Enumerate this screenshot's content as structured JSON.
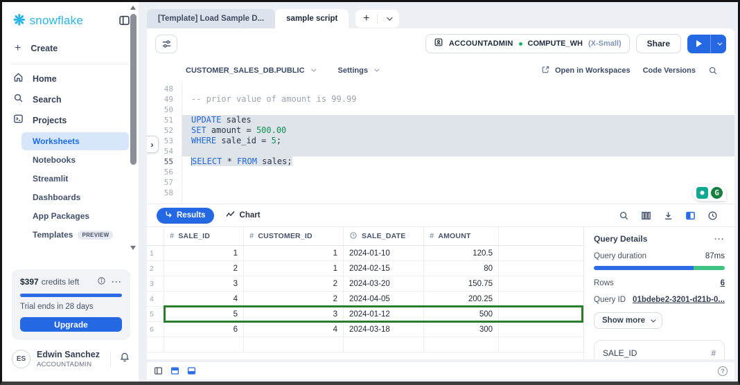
{
  "sidebar": {
    "logo_text": "snowflake",
    "create_label": "Create",
    "nav": [
      {
        "icon": "home",
        "label": "Home"
      },
      {
        "icon": "search",
        "label": "Search"
      },
      {
        "icon": "projects",
        "label": "Projects"
      }
    ],
    "sub_nav": [
      {
        "label": "Worksheets",
        "selected": true
      },
      {
        "label": "Notebooks"
      },
      {
        "label": "Streamlit"
      },
      {
        "label": "Dashboards"
      },
      {
        "label": "App Packages"
      },
      {
        "label": "Templates",
        "badge": "PREVIEW"
      }
    ],
    "credits": {
      "amount": "$397",
      "suffix": "credits left",
      "trial": "Trial ends in 28 days",
      "upgrade_label": "Upgrade"
    },
    "user": {
      "initials": "ES",
      "name": "Edwin Sanchez",
      "role": "ACCOUNTADMIN"
    }
  },
  "tabs": [
    {
      "label": "[Template] Load Sample D...",
      "active": false
    },
    {
      "label": "sample script",
      "active": true
    }
  ],
  "toolbar": {
    "role": "ACCOUNTADMIN",
    "warehouse": "COMPUTE_WH",
    "warehouse_size": "(X-Small)",
    "share_label": "Share"
  },
  "context_bar": {
    "database": "CUSTOMER_SALES_DB.PUBLIC",
    "settings_label": "Settings",
    "open_in_workspaces": "Open in Workspaces",
    "code_versions": "Code Versions"
  },
  "editor": {
    "lines": [
      {
        "no": 48,
        "segments": []
      },
      {
        "no": 49,
        "segments": [
          {
            "text": "-- prior value of amount is 99.99",
            "type": "comment"
          }
        ]
      },
      {
        "no": 50,
        "segments": []
      },
      {
        "no": 51,
        "highlight": "full",
        "segments": [
          {
            "text": "UPDATE",
            "type": "keyword"
          },
          {
            "text": " sales",
            "type": "plain"
          }
        ]
      },
      {
        "no": 52,
        "highlight": "full",
        "segments": [
          {
            "text": "SET",
            "type": "keyword"
          },
          {
            "text": " amount = ",
            "type": "plain"
          },
          {
            "text": "500.00",
            "type": "number"
          }
        ]
      },
      {
        "no": 53,
        "highlight": "full",
        "segments": [
          {
            "text": "WHERE",
            "type": "keyword"
          },
          {
            "text": " sale_id = ",
            "type": "plain"
          },
          {
            "text": "5",
            "type": "number"
          },
          {
            "text": ";",
            "type": "plain"
          }
        ]
      },
      {
        "no": 54,
        "highlight": "full",
        "segments": []
      },
      {
        "no": 55,
        "highlight": "text",
        "cursor": true,
        "active": true,
        "segments": [
          {
            "text": "SELECT",
            "type": "keyword"
          },
          {
            "text": " * ",
            "type": "plain"
          },
          {
            "text": "FROM",
            "type": "keyword"
          },
          {
            "text": " sales;",
            "type": "plain"
          }
        ]
      },
      {
        "no": 56,
        "segments": []
      },
      {
        "no": 57,
        "segments": []
      },
      {
        "no": 58,
        "segments": []
      }
    ]
  },
  "results": {
    "results_tab": "Results",
    "chart_tab": "Chart",
    "table": {
      "columns": [
        {
          "label": "SALE_ID",
          "type": "number"
        },
        {
          "label": "CUSTOMER_ID",
          "type": "number"
        },
        {
          "label": "SALE_DATE",
          "type": "date"
        },
        {
          "label": "AMOUNT",
          "type": "number"
        }
      ],
      "rows": [
        [
          "1",
          "1",
          "2024-01-10",
          "120.5"
        ],
        [
          "2",
          "1",
          "2024-02-15",
          "80"
        ],
        [
          "3",
          "2",
          "2024-03-20",
          "150.75"
        ],
        [
          "4",
          "2",
          "2024-04-05",
          "200.25"
        ],
        [
          "5",
          "3",
          "2024-01-12",
          "500"
        ],
        [
          "6",
          "4",
          "2024-03-18",
          "300"
        ]
      ],
      "highlighted_row": 5
    }
  },
  "query_details": {
    "title": "Query Details",
    "duration_label": "Query duration",
    "duration_value": "87ms",
    "duration_bar": {
      "blue_pct": 76,
      "green_pct": 24
    },
    "rows_label": "Rows",
    "rows_value": "6",
    "query_id_label": "Query ID",
    "query_id_value": "01bdebe2-3201-d21b-0...",
    "show_more_label": "Show more",
    "field_name": "SALE_ID",
    "field_type_icon": "#"
  },
  "colors": {
    "accent_blue": "#2468e4",
    "logo_blue": "#29b5e8",
    "row_highlight_green": "#2b7d2b",
    "duration_blue": "#2e6be6",
    "duration_green": "#41c386",
    "warehouse_dot_green": "#12b76a"
  }
}
